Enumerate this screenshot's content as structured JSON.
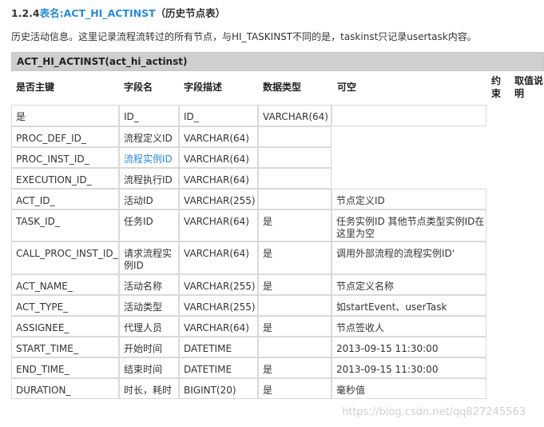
{
  "heading": {
    "number": "1.2.4",
    "name": "表名:ACT_HI_ACTINST",
    "subtitle": "（历史节点表）"
  },
  "intro": "历史活动信息。这里记录流程流转过的所有节点，与HI_TASKINST不同的是，taskinst只记录usertask内容。",
  "table": {
    "title": "ACT_HI_ACTINST(act_hi_actinst)",
    "headers": {
      "pk": "是否主键",
      "field": "字段名",
      "desc": "字段描述",
      "type": "数据类型",
      "nullable": "可空",
      "constraint": "约束",
      "values": "取值说明"
    },
    "rows": [
      {
        "c1": "是",
        "c2": "ID_",
        "c3": "ID_",
        "c4": "VARCHAR(64)",
        "c5": ""
      },
      {
        "c1": "PROC_DEF_ID_",
        "c2": "流程定义ID",
        "c3": "VARCHAR(64)",
        "c4": "",
        "c5": ""
      },
      {
        "c1": "PROC_INST_ID_",
        "c2": "流程实例ID",
        "c3": "VARCHAR(64)",
        "c4": "",
        "c5": ""
      },
      {
        "c1": "EXECUTION_ID_",
        "c2": "流程执行ID",
        "c3": "VARCHAR(64)",
        "c4": "",
        "c5": ""
      },
      {
        "c1": "ACT_ID_",
        "c2": "活动ID",
        "c3": "VARCHAR(255)",
        "c4": "",
        "c5": "节点定义ID"
      },
      {
        "c1": "TASK_ID_",
        "c2": "任务ID",
        "c3": "VARCHAR(64)",
        "c4": "是",
        "c5": "任务实例ID 其他节点类型实例ID在这里为空"
      },
      {
        "c1": "CALL_PROC_INST_ID_",
        "c2": "请求流程实例ID",
        "c3": "VARCHAR(64)",
        "c4": "是",
        "c5": "调用外部流程的流程实例ID'"
      },
      {
        "c1": "ACT_NAME_",
        "c2": "活动名称",
        "c3": "VARCHAR(255)",
        "c4": "是",
        "c5": "节点定义名称"
      },
      {
        "c1": "ACT_TYPE_",
        "c2": "活动类型",
        "c3": "VARCHAR(255)",
        "c4": "",
        "c5": "如startEvent、userTask"
      },
      {
        "c1": "ASSIGNEE_",
        "c2": "代理人员",
        "c3": "VARCHAR(64)",
        "c4": "是",
        "c5": "节点签收人"
      },
      {
        "c1": "START_TIME_",
        "c2": "开始时间",
        "c3": "DATETIME",
        "c4": "",
        "c5": "2013-09-15 11:30:00"
      },
      {
        "c1": "END_TIME_",
        "c2": "结束时间",
        "c3": "DATETIME",
        "c4": "是",
        "c5": "2013-09-15 11:30:00"
      },
      {
        "c1": "DURATION_",
        "c2": "时长，耗时",
        "c3": "BIGINT(20)",
        "c4": "是",
        "c5": "毫秒值"
      }
    ]
  },
  "watermark": "https://blog.csdn.net/qq827245563"
}
